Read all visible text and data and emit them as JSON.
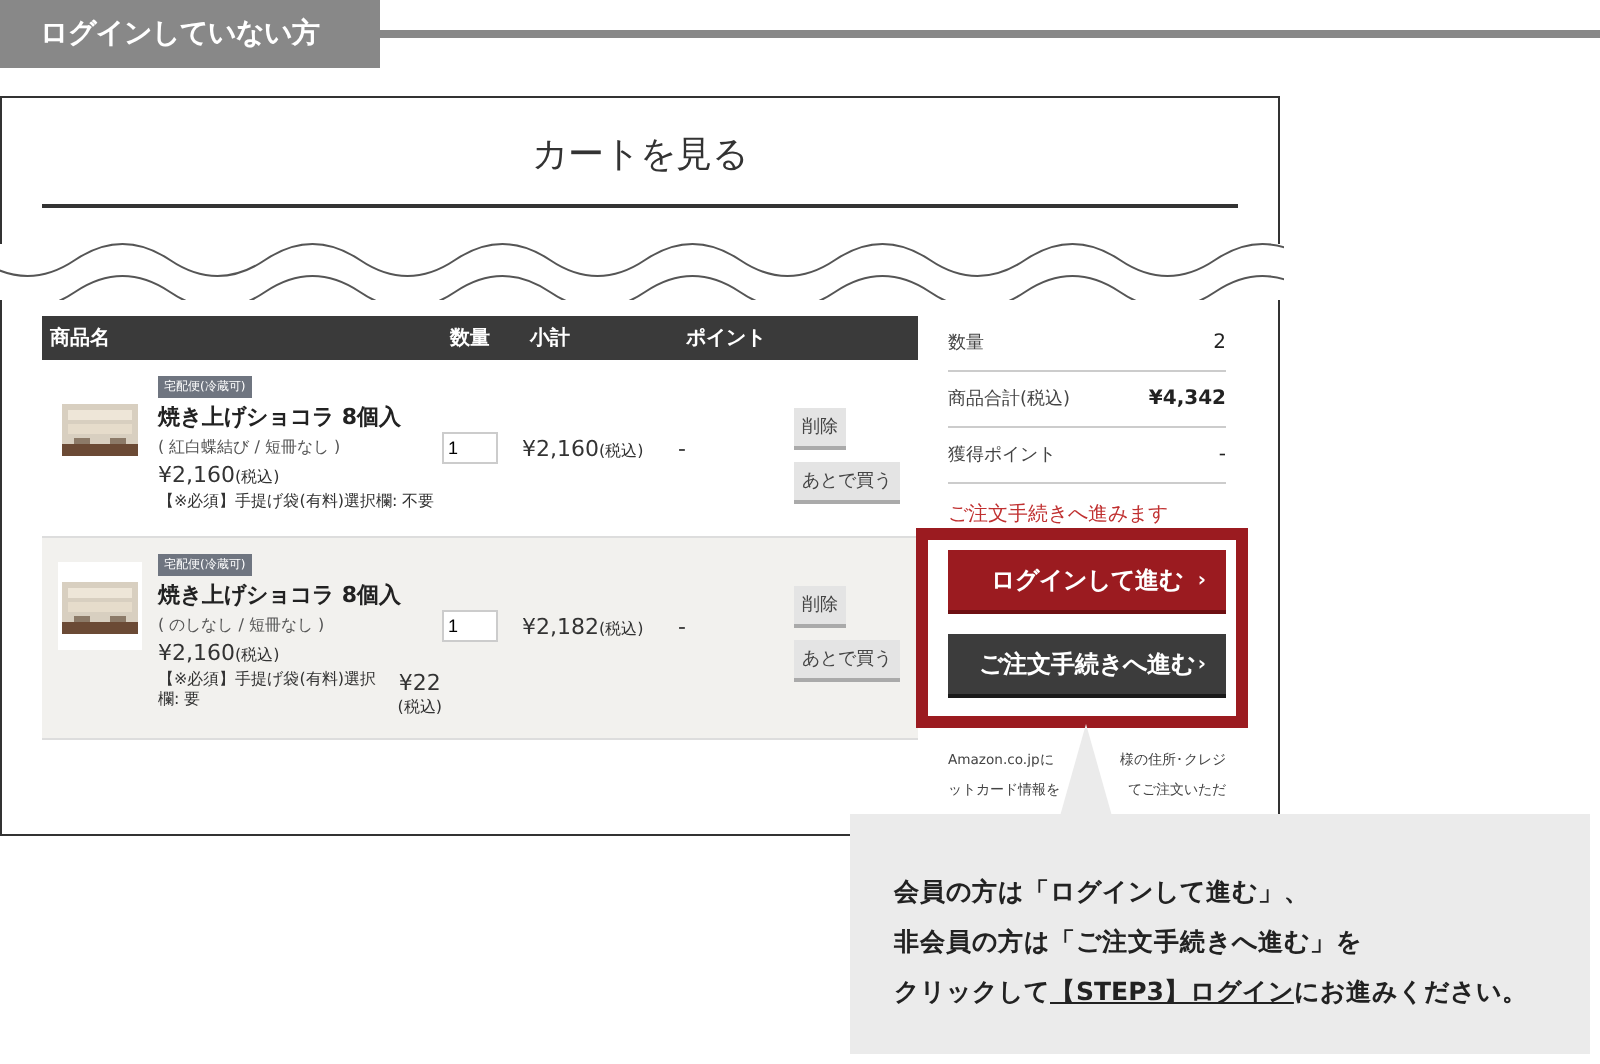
{
  "section_tag": "ログインしていない方",
  "cart": {
    "title": "カートを見る",
    "columns": [
      "商品名",
      "数量",
      "小計",
      "ポイント"
    ],
    "items": [
      {
        "badge": "宅配便(冷蔵可)",
        "name": "焼き上げショコラ 8個入",
        "options": "( 紅白蝶結び / 短冊なし )",
        "price": "¥2,160",
        "price_note": "(税込)",
        "note": "【※必須】手提げ袋(有料)選択欄: 不要",
        "qty": "1",
        "subtotal": "¥2,160",
        "subtotal_note": "(税込)",
        "point": "-",
        "delete": "削除",
        "later": "あとで買う"
      },
      {
        "badge": "宅配便(冷蔵可)",
        "name": "焼き上げショコラ 8個入",
        "options": "( のしなし / 短冊なし )",
        "price": "¥2,160",
        "price_note": "(税込)",
        "note": "【※必須】手提げ袋(有料)選択欄: 要",
        "note_price": "¥22",
        "note_price_note": "(税込)",
        "qty": "1",
        "subtotal": "¥2,182",
        "subtotal_note": "(税込)",
        "point": "-",
        "delete": "削除",
        "later": "あとで買う"
      }
    ]
  },
  "summary": {
    "rows": [
      {
        "label": "数量",
        "value": "2"
      },
      {
        "label": "商品合計(税込)",
        "value": "¥4,342"
      },
      {
        "label": "獲得ポイント",
        "value": "-"
      }
    ],
    "notice": "ご注文手続きへ進みます",
    "login_button": "ログインして進む",
    "guest_button": "ご注文手続きへ進む",
    "arrow": "›",
    "amazon_text": [
      [
        "Amazon.co.jpに",
        "様の住所･クレジ"
      ],
      [
        "ットカード情報を",
        "てご注文いただ"
      ]
    ]
  },
  "callout": {
    "lines": [
      "会員の方は「ログインして進む」、",
      "非会員の方は「ご注文手続きへ進む」を"
    ],
    "prefix": "クリックして",
    "link": "【STEP3】ログイン",
    "suffix": "にお進みください。"
  }
}
